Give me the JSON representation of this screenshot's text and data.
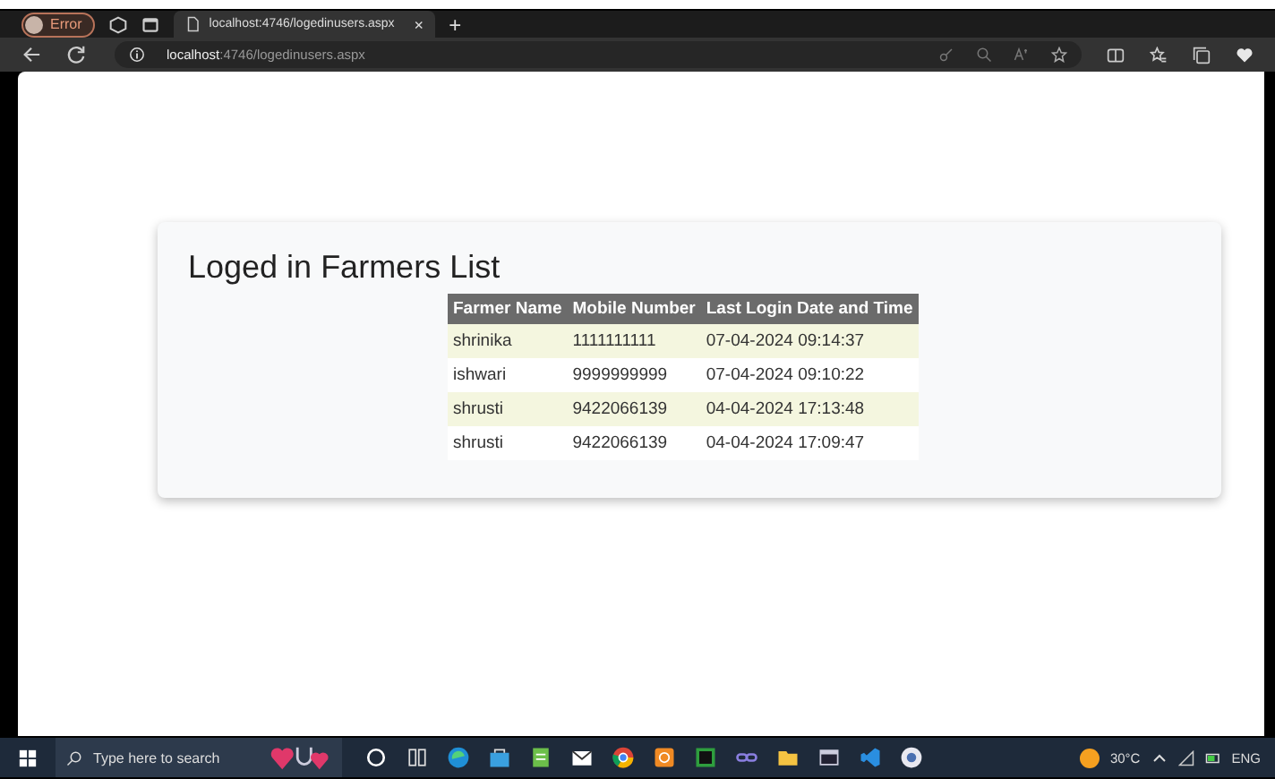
{
  "browser": {
    "profile": "Error",
    "tab_title": "localhost:4746/logedinusers.aspx",
    "tab_close": "×",
    "new_tab": "+",
    "address_host": "localhost",
    "address_path": ":4746/logedinusers.aspx"
  },
  "page": {
    "title": "Loged in Farmers List",
    "table": {
      "columns": [
        "Farmer Name",
        "Mobile Number",
        "Last Login Date and Time"
      ],
      "rows": [
        [
          "shrinika",
          "1111111111",
          "07-04-2024 09:14:37"
        ],
        [
          "ishwari",
          "9999999999",
          "07-04-2024 09:10:22"
        ],
        [
          "shrusti",
          "9422066139",
          "04-04-2024 17:13:48"
        ],
        [
          "shrusti",
          "9422066139",
          "04-04-2024 17:09:47"
        ]
      ]
    }
  },
  "taskbar": {
    "search_placeholder": "Type here to search",
    "weather": "30°C",
    "language": "ENG"
  }
}
